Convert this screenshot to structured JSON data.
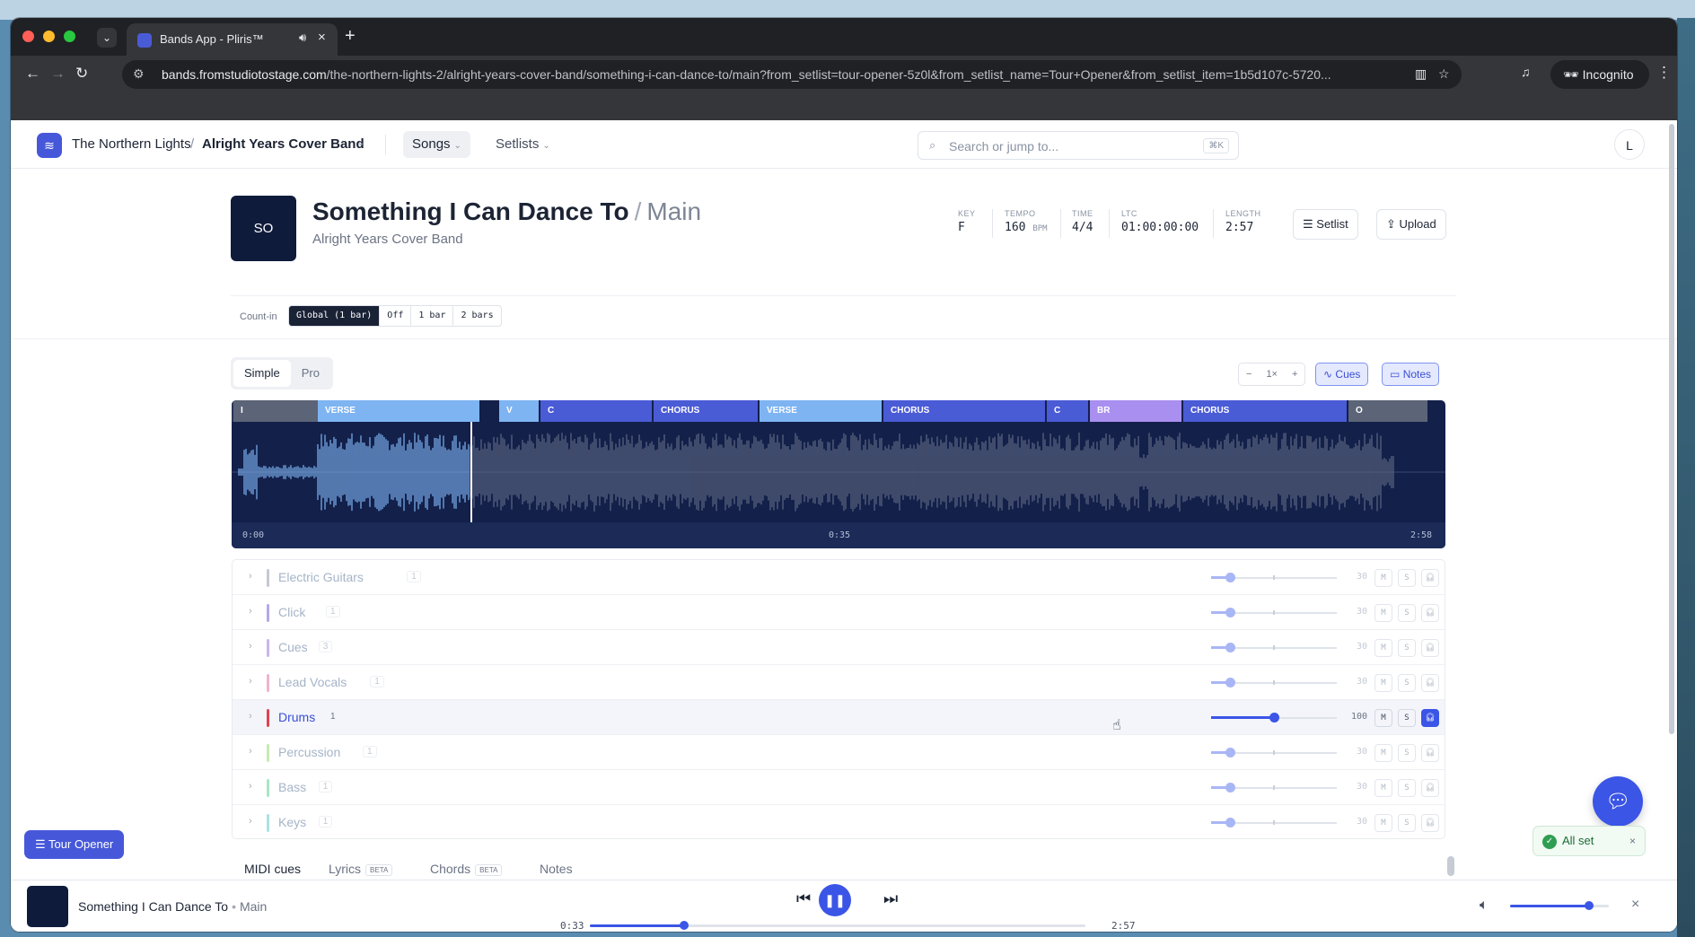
{
  "browser": {
    "tab_title": "Bands App - Pliris™",
    "tab_audio_icon": "speaker-icon",
    "url_host": "bands.fromstudiotostage.com",
    "url_path": "/the-northern-lights-2/alright-years-cover-band/something-i-can-dance-to/main?from_setlist=tour-opener-5z0l&from_setlist_name=Tour+Opener&from_setlist_item=1b5d107c-5720...",
    "incognito_label": "Incognito"
  },
  "header": {
    "org": "The Northern Lights",
    "band": "Alright Years Cover Band",
    "nav": [
      "Songs",
      "Setlists"
    ],
    "search_placeholder": "Search or jump to...",
    "search_shortcut": "⌘K",
    "avatar_initial": "L"
  },
  "song": {
    "art_initials": "SO",
    "title": "Something I Can Dance To",
    "version": "Main",
    "band": "Alright Years Cover Band",
    "meta": {
      "key_label": "KEY",
      "key": "F",
      "tempo_label": "TEMPO",
      "tempo": "160",
      "tempo_unit": "BPM",
      "time_label": "TIME",
      "time": "4/4",
      "ltc_label": "LTC",
      "ltc": "01:00:00:00",
      "length_label": "LENGTH",
      "length": "2:57"
    },
    "buttons": {
      "setlist": "Setlist",
      "upload": "Upload"
    }
  },
  "count_in": {
    "label": "Count-in",
    "options": [
      "Global (1 bar)",
      "Off",
      "1 bar",
      "2 bars"
    ],
    "selected": "Global (1 bar)"
  },
  "view": {
    "modes": [
      "Simple",
      "Pro"
    ],
    "selected_mode": "Simple",
    "zoom_minus": "−",
    "zoom_level": "1×",
    "zoom_plus": "+",
    "cues_label": "Cues",
    "notes_label": "Notes"
  },
  "waveform": {
    "sections": [
      {
        "label": "I",
        "color": "#5c6477"
      },
      {
        "label": "VERSE",
        "color": "#7eb4f2"
      },
      {
        "label": "V",
        "color": "#7eb4f2"
      },
      {
        "label": "C",
        "color": "#4a5bd6"
      },
      {
        "label": "CHORUS",
        "color": "#4a5bd6"
      },
      {
        "label": "VERSE",
        "color": "#7eb4f2"
      },
      {
        "label": "CHORUS",
        "color": "#4a5bd6"
      },
      {
        "label": "C",
        "color": "#4a5bd6"
      },
      {
        "label": "BR",
        "color": "#a98ff0"
      },
      {
        "label": "CHORUS",
        "color": "#4a5bd6"
      },
      {
        "label": "O",
        "color": "#5c6477"
      }
    ],
    "time_start": "0:00",
    "time_mid": "0:35",
    "time_end": "2:58",
    "played_color": "#7eb4f2",
    "unplayed_color": "#5d6882"
  },
  "tracks": [
    {
      "name": "Electric Guitars",
      "count": "1",
      "color": "#c3c9d4",
      "volume": "30",
      "level": 0.3,
      "selected": false
    },
    {
      "name": "Click",
      "count": "1",
      "color": "#b3a8ea",
      "volume": "30",
      "level": 0.3,
      "selected": false
    },
    {
      "name": "Cues",
      "count": "3",
      "color": "#cdb5ec",
      "volume": "30",
      "level": 0.3,
      "selected": false
    },
    {
      "name": "Lead Vocals",
      "count": "1",
      "color": "#f2b3cf",
      "volume": "30",
      "level": 0.3,
      "selected": false
    },
    {
      "name": "Drums",
      "count": "1",
      "color": "#e2424f",
      "volume": "100",
      "level": 1.0,
      "selected": true
    },
    {
      "name": "Percussion",
      "count": "1",
      "color": "#c8eab0",
      "volume": "30",
      "level": 0.3,
      "selected": false
    },
    {
      "name": "Bass",
      "count": "1",
      "color": "#a8e6c4",
      "volume": "30",
      "level": 0.3,
      "selected": false
    },
    {
      "name": "Keys",
      "count": "1",
      "color": "#a8e3e3",
      "volume": "30",
      "level": 0.3,
      "selected": false
    }
  ],
  "track_buttons": {
    "mute": "M",
    "solo": "S"
  },
  "bottom_tabs": {
    "midi": "MIDI cues",
    "lyrics": "Lyrics",
    "chords": "Chords",
    "notes": "Notes",
    "beta": "BETA"
  },
  "tour_button": "Tour Opener",
  "toast": {
    "message": "All set"
  },
  "player": {
    "title": "Something I Can Dance To",
    "version": "Main",
    "current": "0:33",
    "total": "2:57",
    "progress": 0.19,
    "volume": 0.8
  }
}
